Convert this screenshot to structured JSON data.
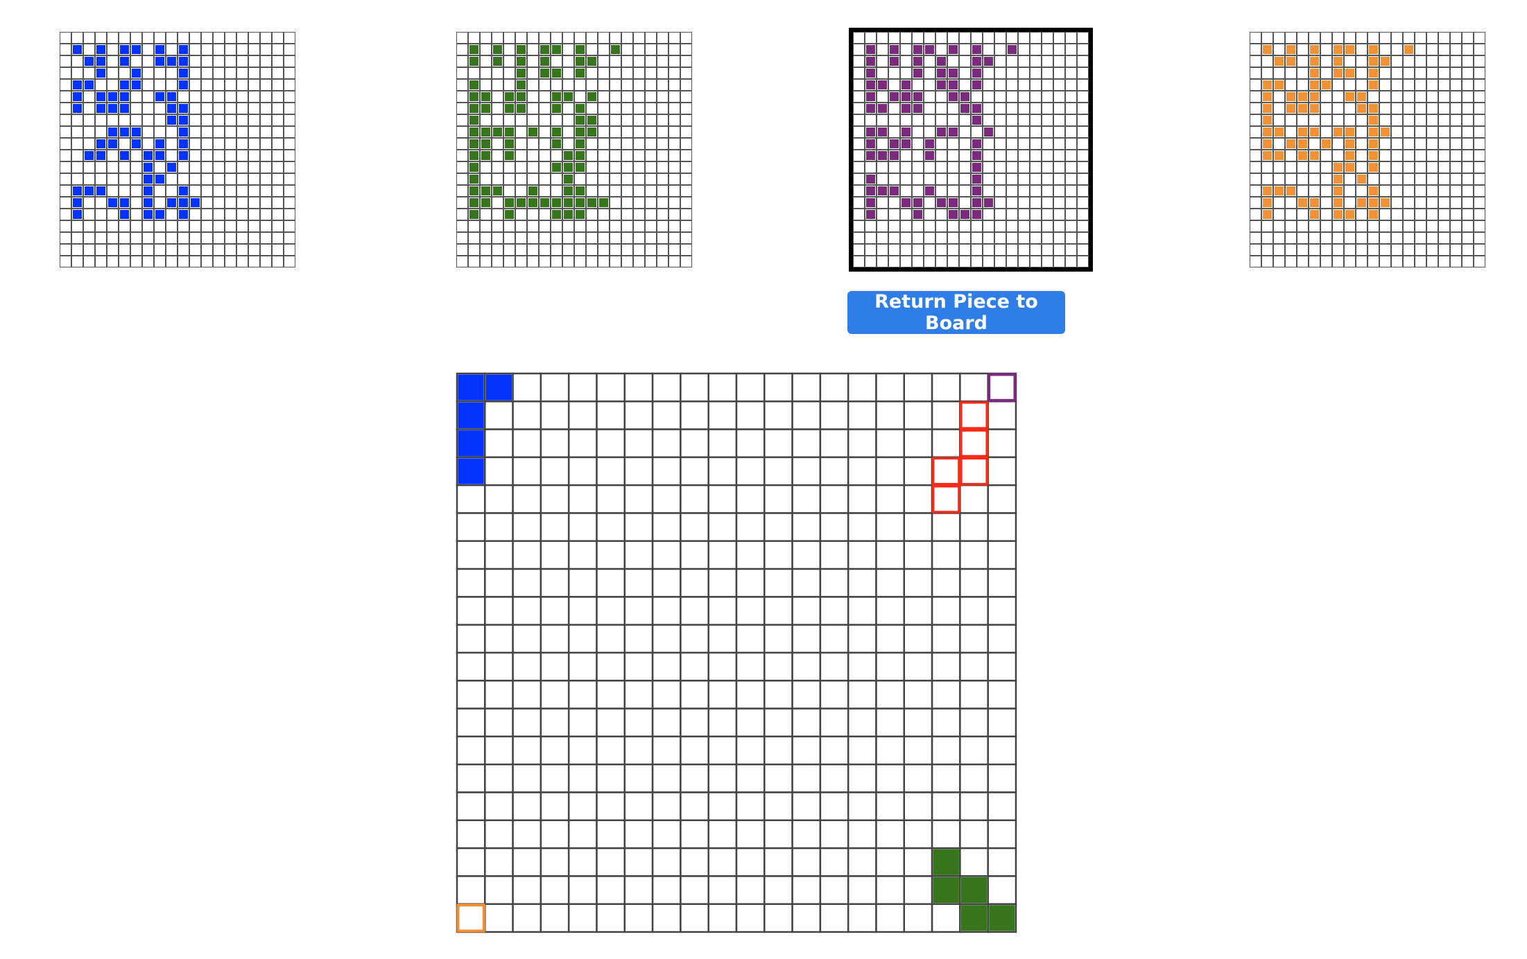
{
  "game": {
    "board_size": 20,
    "inventory_size": 20,
    "selected_inventory": "purple",
    "return_button_label": "Return Piece to Board",
    "colors": {
      "blue": "#0433ff",
      "green": "#38761d",
      "purple": "#7b2a7e",
      "orange": "#f19236",
      "highlight": "#ff2a17",
      "grid": "#444444"
    },
    "inventories": [
      {
        "id": "blue",
        "cells": [
          [
            1,
            1
          ],
          [
            1,
            3
          ],
          [
            1,
            5
          ],
          [
            1,
            6
          ],
          [
            1,
            8
          ],
          [
            1,
            10
          ],
          [
            2,
            2
          ],
          [
            2,
            3
          ],
          [
            2,
            5
          ],
          [
            2,
            8
          ],
          [
            2,
            9
          ],
          [
            2,
            10
          ],
          [
            3,
            3
          ],
          [
            3,
            6
          ],
          [
            3,
            10
          ],
          [
            4,
            1
          ],
          [
            4,
            2
          ],
          [
            4,
            5
          ],
          [
            4,
            6
          ],
          [
            4,
            10
          ],
          [
            5,
            1
          ],
          [
            5,
            3
          ],
          [
            5,
            4
          ],
          [
            5,
            5
          ],
          [
            5,
            8
          ],
          [
            5,
            9
          ],
          [
            6,
            1
          ],
          [
            6,
            3
          ],
          [
            6,
            4
          ],
          [
            6,
            5
          ],
          [
            6,
            9
          ],
          [
            6,
            10
          ],
          [
            7,
            9
          ],
          [
            7,
            10
          ],
          [
            8,
            4
          ],
          [
            8,
            5
          ],
          [
            8,
            6
          ],
          [
            8,
            10
          ],
          [
            9,
            3
          ],
          [
            9,
            4
          ],
          [
            9,
            6
          ],
          [
            9,
            8
          ],
          [
            9,
            10
          ],
          [
            10,
            2
          ],
          [
            10,
            3
          ],
          [
            10,
            5
          ],
          [
            10,
            7
          ],
          [
            10,
            8
          ],
          [
            10,
            10
          ],
          [
            11,
            7
          ],
          [
            11,
            9
          ],
          [
            12,
            7
          ],
          [
            12,
            8
          ],
          [
            13,
            1
          ],
          [
            13,
            2
          ],
          [
            13,
            3
          ],
          [
            13,
            7
          ],
          [
            13,
            10
          ],
          [
            14,
            1
          ],
          [
            14,
            4
          ],
          [
            14,
            5
          ],
          [
            14,
            7
          ],
          [
            14,
            9
          ],
          [
            14,
            10
          ],
          [
            14,
            11
          ],
          [
            15,
            1
          ],
          [
            15,
            5
          ],
          [
            15,
            7
          ],
          [
            15,
            8
          ],
          [
            15,
            10
          ]
        ]
      },
      {
        "id": "green",
        "cells": [
          [
            1,
            1
          ],
          [
            1,
            3
          ],
          [
            1,
            5
          ],
          [
            1,
            7
          ],
          [
            1,
            8
          ],
          [
            1,
            10
          ],
          [
            1,
            13
          ],
          [
            2,
            1
          ],
          [
            2,
            3
          ],
          [
            2,
            5
          ],
          [
            2,
            7
          ],
          [
            2,
            10
          ],
          [
            2,
            11
          ],
          [
            3,
            5
          ],
          [
            3,
            7
          ],
          [
            3,
            8
          ],
          [
            3,
            10
          ],
          [
            4,
            1
          ],
          [
            4,
            5
          ],
          [
            5,
            1
          ],
          [
            5,
            2
          ],
          [
            5,
            4
          ],
          [
            5,
            5
          ],
          [
            5,
            8
          ],
          [
            5,
            9
          ],
          [
            5,
            11
          ],
          [
            6,
            1
          ],
          [
            6,
            2
          ],
          [
            6,
            4
          ],
          [
            6,
            5
          ],
          [
            6,
            8
          ],
          [
            6,
            10
          ],
          [
            7,
            1
          ],
          [
            7,
            10
          ],
          [
            7,
            11
          ],
          [
            8,
            1
          ],
          [
            8,
            2
          ],
          [
            8,
            3
          ],
          [
            8,
            4
          ],
          [
            8,
            6
          ],
          [
            8,
            8
          ],
          [
            8,
            10
          ],
          [
            8,
            11
          ],
          [
            9,
            1
          ],
          [
            9,
            2
          ],
          [
            9,
            4
          ],
          [
            9,
            8
          ],
          [
            9,
            10
          ],
          [
            10,
            1
          ],
          [
            10,
            2
          ],
          [
            10,
            4
          ],
          [
            10,
            9
          ],
          [
            10,
            10
          ],
          [
            11,
            1
          ],
          [
            11,
            8
          ],
          [
            11,
            9
          ],
          [
            11,
            10
          ],
          [
            12,
            1
          ],
          [
            12,
            9
          ],
          [
            13,
            1
          ],
          [
            13,
            2
          ],
          [
            13,
            3
          ],
          [
            13,
            6
          ],
          [
            13,
            9
          ],
          [
            13,
            10
          ],
          [
            14,
            1
          ],
          [
            14,
            2
          ],
          [
            14,
            4
          ],
          [
            14,
            5
          ],
          [
            14,
            6
          ],
          [
            14,
            7
          ],
          [
            14,
            8
          ],
          [
            14,
            9
          ],
          [
            14,
            10
          ],
          [
            14,
            11
          ],
          [
            14,
            12
          ],
          [
            15,
            1
          ],
          [
            15,
            4
          ],
          [
            15,
            8
          ],
          [
            15,
            9
          ],
          [
            15,
            10
          ]
        ]
      },
      {
        "id": "purple",
        "cells": [
          [
            1,
            1
          ],
          [
            1,
            3
          ],
          [
            1,
            5
          ],
          [
            1,
            6
          ],
          [
            1,
            8
          ],
          [
            1,
            10
          ],
          [
            1,
            13
          ],
          [
            2,
            1
          ],
          [
            2,
            3
          ],
          [
            2,
            5
          ],
          [
            2,
            7
          ],
          [
            2,
            10
          ],
          [
            2,
            11
          ],
          [
            3,
            1
          ],
          [
            3,
            5
          ],
          [
            3,
            7
          ],
          [
            3,
            8
          ],
          [
            3,
            10
          ],
          [
            4,
            1
          ],
          [
            4,
            2
          ],
          [
            4,
            4
          ],
          [
            4,
            7
          ],
          [
            4,
            8
          ],
          [
            4,
            10
          ],
          [
            5,
            1
          ],
          [
            5,
            3
          ],
          [
            5,
            4
          ],
          [
            5,
            5
          ],
          [
            5,
            8
          ],
          [
            5,
            9
          ],
          [
            6,
            1
          ],
          [
            6,
            2
          ],
          [
            6,
            4
          ],
          [
            6,
            5
          ],
          [
            6,
            9
          ],
          [
            6,
            10
          ],
          [
            7,
            10
          ],
          [
            8,
            1
          ],
          [
            8,
            2
          ],
          [
            8,
            4
          ],
          [
            8,
            7
          ],
          [
            8,
            8
          ],
          [
            8,
            11
          ],
          [
            9,
            1
          ],
          [
            9,
            3
          ],
          [
            9,
            4
          ],
          [
            9,
            6
          ],
          [
            9,
            10
          ],
          [
            10,
            1
          ],
          [
            10,
            2
          ],
          [
            10,
            3
          ],
          [
            10,
            6
          ],
          [
            10,
            10
          ],
          [
            11,
            10
          ],
          [
            12,
            1
          ],
          [
            12,
            10
          ],
          [
            13,
            1
          ],
          [
            13,
            2
          ],
          [
            13,
            3
          ],
          [
            13,
            6
          ],
          [
            13,
            10
          ],
          [
            14,
            1
          ],
          [
            14,
            4
          ],
          [
            14,
            5
          ],
          [
            14,
            7
          ],
          [
            14,
            8
          ],
          [
            14,
            10
          ],
          [
            14,
            11
          ],
          [
            15,
            1
          ],
          [
            15,
            5
          ],
          [
            15,
            8
          ],
          [
            15,
            9
          ],
          [
            15,
            10
          ]
        ]
      },
      {
        "id": "orange",
        "cells": [
          [
            1,
            1
          ],
          [
            1,
            3
          ],
          [
            1,
            5
          ],
          [
            1,
            7
          ],
          [
            1,
            8
          ],
          [
            1,
            10
          ],
          [
            1,
            13
          ],
          [
            2,
            2
          ],
          [
            2,
            3
          ],
          [
            2,
            5
          ],
          [
            2,
            7
          ],
          [
            2,
            10
          ],
          [
            2,
            11
          ],
          [
            3,
            5
          ],
          [
            3,
            7
          ],
          [
            3,
            8
          ],
          [
            3,
            10
          ],
          [
            4,
            1
          ],
          [
            4,
            2
          ],
          [
            4,
            5
          ],
          [
            4,
            6
          ],
          [
            4,
            10
          ],
          [
            5,
            1
          ],
          [
            5,
            3
          ],
          [
            5,
            4
          ],
          [
            5,
            5
          ],
          [
            5,
            8
          ],
          [
            5,
            9
          ],
          [
            6,
            1
          ],
          [
            6,
            3
          ],
          [
            6,
            4
          ],
          [
            6,
            5
          ],
          [
            6,
            9
          ],
          [
            6,
            10
          ],
          [
            7,
            1
          ],
          [
            7,
            10
          ],
          [
            8,
            1
          ],
          [
            8,
            2
          ],
          [
            8,
            4
          ],
          [
            8,
            5
          ],
          [
            8,
            7
          ],
          [
            8,
            8
          ],
          [
            8,
            10
          ],
          [
            8,
            11
          ],
          [
            9,
            1
          ],
          [
            9,
            3
          ],
          [
            9,
            4
          ],
          [
            9,
            6
          ],
          [
            9,
            8
          ],
          [
            9,
            10
          ],
          [
            10,
            1
          ],
          [
            10,
            2
          ],
          [
            10,
            4
          ],
          [
            10,
            5
          ],
          [
            10,
            8
          ],
          [
            10,
            10
          ],
          [
            11,
            7
          ],
          [
            11,
            8
          ],
          [
            11,
            10
          ],
          [
            12,
            7
          ],
          [
            12,
            9
          ],
          [
            13,
            1
          ],
          [
            13,
            2
          ],
          [
            13,
            3
          ],
          [
            13,
            7
          ],
          [
            13,
            10
          ],
          [
            14,
            1
          ],
          [
            14,
            4
          ],
          [
            14,
            5
          ],
          [
            14,
            7
          ],
          [
            14,
            9
          ],
          [
            14,
            10
          ],
          [
            14,
            11
          ],
          [
            15,
            1
          ],
          [
            15,
            5
          ],
          [
            15,
            7
          ],
          [
            15,
            8
          ],
          [
            15,
            10
          ]
        ]
      }
    ],
    "board_pieces": [
      {
        "color": "blue",
        "cells": [
          [
            0,
            0
          ],
          [
            0,
            1
          ],
          [
            1,
            0
          ],
          [
            2,
            0
          ],
          [
            3,
            0
          ]
        ]
      },
      {
        "color": "green",
        "cells": [
          [
            17,
            17
          ],
          [
            18,
            17
          ],
          [
            18,
            18
          ],
          [
            19,
            18
          ],
          [
            19,
            19
          ]
        ]
      }
    ],
    "board_highlight": [
      [
        1,
        18
      ],
      [
        2,
        18
      ],
      [
        3,
        17
      ],
      [
        3,
        18
      ],
      [
        4,
        17
      ]
    ],
    "corner_markers": [
      {
        "color": "purple",
        "corner": "top-right"
      },
      {
        "color": "orange",
        "corner": "bottom-left"
      }
    ]
  }
}
